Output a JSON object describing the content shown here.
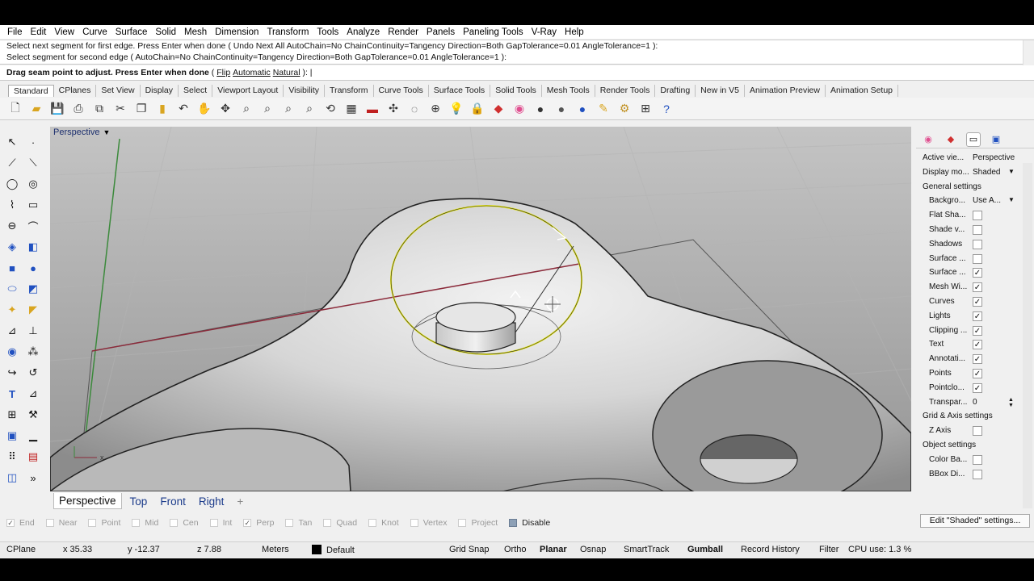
{
  "menu": [
    "File",
    "Edit",
    "View",
    "Curve",
    "Surface",
    "Solid",
    "Mesh",
    "Dimension",
    "Transform",
    "Tools",
    "Analyze",
    "Render",
    "Panels",
    "Paneling Tools",
    "V-Ray",
    "Help"
  ],
  "command": {
    "history": [
      "Select next segment for first edge. Press Enter when done ( Undo  Next  All  AutoChain=No  ChainContinuity=Tangency  Direction=Both  GapTolerance=0.01  AngleTolerance=1 ):",
      "Select segment for second edge ( AutoChain=No  ChainContinuity=Tangency  Direction=Both  GapTolerance=0.01  AngleTolerance=1 ):"
    ],
    "prompt_prefix": "Drag seam point to adjust. Press Enter when done",
    "prompt_open": " ( ",
    "options": [
      "Flip",
      "Automatic",
      "Natural"
    ],
    "prompt_close": " ): |"
  },
  "toolbar_tabs": [
    "Standard",
    "CPlanes",
    "Set View",
    "Display",
    "Select",
    "Viewport Layout",
    "Visibility",
    "Transform",
    "Curve Tools",
    "Surface Tools",
    "Solid Tools",
    "Mesh Tools",
    "Render Tools",
    "Drafting",
    "New in V5",
    "Animation Preview",
    "Animation Setup"
  ],
  "viewport": {
    "title": "Perspective",
    "tabs": [
      "Perspective",
      "Top",
      "Front",
      "Right",
      "+"
    ]
  },
  "osnaps": [
    {
      "label": "End",
      "checked": true
    },
    {
      "label": "Near",
      "checked": false
    },
    {
      "label": "Point",
      "checked": false
    },
    {
      "label": "Mid",
      "checked": false
    },
    {
      "label": "Cen",
      "checked": false
    },
    {
      "label": "Int",
      "checked": false
    },
    {
      "label": "Perp",
      "checked": true
    },
    {
      "label": "Tan",
      "checked": false
    },
    {
      "label": "Quad",
      "checked": false
    },
    {
      "label": "Knot",
      "checked": false
    },
    {
      "label": "Vertex",
      "checked": false
    },
    {
      "label": "Project",
      "checked": false
    },
    {
      "label": "Disable",
      "checked": false
    }
  ],
  "status": {
    "cplane": "CPlane",
    "x": "x 35.33",
    "y": "y -12.37",
    "z": "z 7.88",
    "units": "Meters",
    "layer": "Default",
    "grid_snap": "Grid Snap",
    "ortho": "Ortho",
    "planar": "Planar",
    "osnap": "Osnap",
    "smarttrack": "SmartTrack",
    "gumball": "Gumball",
    "record_history": "Record History",
    "filter": "Filter",
    "cpu": "CPU use: 1.3 %"
  },
  "panel": {
    "active_view_label": "Active vie...",
    "active_view_value": "Perspective",
    "display_mode_label": "Display mo...",
    "display_mode_value": "Shaded",
    "general_settings": "General settings",
    "background_label": "Backgro...",
    "background_value": "Use A...",
    "items": [
      {
        "label": "Flat Sha...",
        "checked": false
      },
      {
        "label": "Shade v...",
        "checked": false
      },
      {
        "label": "Shadows",
        "checked": false
      },
      {
        "label": "Surface ...",
        "checked": false
      },
      {
        "label": "Surface ...",
        "checked": true
      },
      {
        "label": "Mesh Wi...",
        "checked": true
      },
      {
        "label": "Curves",
        "checked": true
      },
      {
        "label": "Lights",
        "checked": true
      },
      {
        "label": "Clipping ...",
        "checked": true
      },
      {
        "label": "Text",
        "checked": true
      },
      {
        "label": "Annotati...",
        "checked": true
      },
      {
        "label": "Points",
        "checked": true
      },
      {
        "label": "Pointclo...",
        "checked": true
      }
    ],
    "transparency_label": "Transpar...",
    "transparency_value": "0",
    "grid_axis_settings": "Grid & Axis settings",
    "z_axis_label": "Z Axis",
    "object_settings": "Object settings",
    "color_back_label": "Color Ba...",
    "bbox_label": "BBox Di...",
    "edit_button": "Edit \"Shaded\" settings..."
  },
  "colors": {
    "selection_yellow": "#e8e820",
    "x_axis": "#8b2a3a",
    "y_axis": "#3c8a3c",
    "title_blue": "#1c2f6e"
  }
}
